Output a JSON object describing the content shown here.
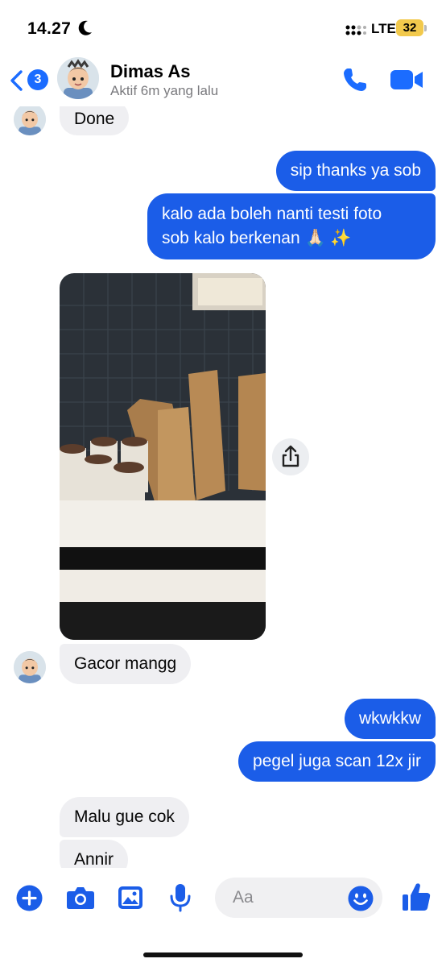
{
  "status_bar": {
    "time": "14.27",
    "network": "LTE",
    "battery": "32"
  },
  "header": {
    "back_badge": "3",
    "contact_name": "Dimas As",
    "contact_status": "Aktif 6m yang lalu"
  },
  "messages": [
    {
      "dir": "in",
      "text": "Done"
    },
    {
      "dir": "out",
      "text": "sip thanks ya sob"
    },
    {
      "dir": "out",
      "lines": [
        "kalo ada boleh nanti testi foto",
        "sob kalo berkenan 🙏🏻 ✨"
      ]
    },
    {
      "dir": "in",
      "type": "photo",
      "description_hidden": true
    },
    {
      "dir": "in",
      "text": "Gacor mangg"
    },
    {
      "dir": "out",
      "text": "wkwkkw"
    },
    {
      "dir": "out",
      "text": "pegel juga scan 12x jir"
    },
    {
      "dir": "in",
      "text": "Malu gue cok"
    },
    {
      "dir": "in",
      "text": "Annir"
    }
  ],
  "composer": {
    "placeholder": "Aa"
  },
  "colors": {
    "accent": "#1b5de8",
    "incoming_bubble": "#efeff2",
    "battery": "#f2c94c"
  },
  "icons": [
    "moon-icon",
    "signal-icon",
    "back-chevron-icon",
    "phone-icon",
    "video-camera-icon",
    "share-icon",
    "plus-icon",
    "camera-icon",
    "gallery-icon",
    "microphone-icon",
    "emoji-icon",
    "thumbs-up-icon"
  ]
}
